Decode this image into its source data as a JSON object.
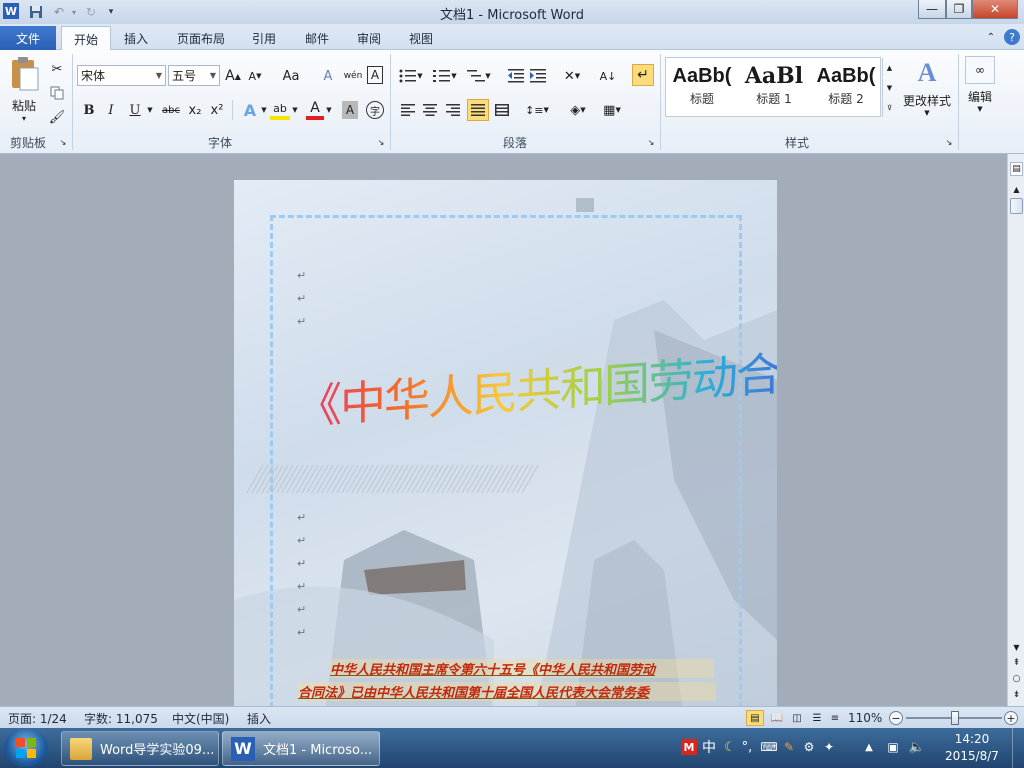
{
  "window": {
    "title": "文档1  -  Microsoft Word",
    "app_icon": "W",
    "minimize": "—",
    "restore": "❐",
    "close": "✕"
  },
  "quick_access": {
    "save_icon": "save-icon",
    "undo_icon": "undo-icon",
    "redo_icon": "redo-icon",
    "customize_icon": "dropdown-icon"
  },
  "tabs": [
    {
      "label": "文件"
    },
    {
      "label": "开始"
    },
    {
      "label": "插入"
    },
    {
      "label": "页面布局"
    },
    {
      "label": "引用"
    },
    {
      "label": "邮件"
    },
    {
      "label": "审阅"
    },
    {
      "label": "视图"
    }
  ],
  "ribbon": {
    "clipboard": {
      "paste_label": "粘贴",
      "group_label": "剪贴板"
    },
    "font": {
      "font_name": "宋体",
      "font_size": "五号",
      "grow": "A",
      "shrink": "A",
      "case": "Aa",
      "bold": "B",
      "italic": "I",
      "underline": "U",
      "strike": "abc",
      "subscript": "x₂",
      "superscript": "x²",
      "text_effect": "A",
      "highlight": "ab",
      "font_color": "A",
      "char_shading": "A",
      "enclose": "字",
      "clear": "A",
      "phonetic": "wén",
      "border_char": "A",
      "group_label": "字体"
    },
    "paragraph": {
      "group_label": "段落"
    },
    "styles": {
      "items": [
        {
          "sample": "AaBb(",
          "name": "标题"
        },
        {
          "sample": "AaBl",
          "name": "标题 1"
        },
        {
          "sample": "AaBb(",
          "name": "标题 2"
        }
      ],
      "change_styles": "更改样式",
      "group_label": "样式"
    },
    "editing": {
      "label": "编辑"
    }
  },
  "document": {
    "paragraph_mark": "↵",
    "wordart": "《中华人民共和国劳动合同法》",
    "line1": "中华人民共和国主席令第六十五号《中华人民共和国劳动",
    "line2": "合同法》已由中华人民共和国第十届全国人民代表大会常务委"
  },
  "status": {
    "page": "页面: 1/24",
    "words": "字数: 11,075",
    "language": "中文(中国)",
    "mode": "插入",
    "zoom": "110%",
    "zoom_minus": "−",
    "zoom_plus": "+",
    "zoom_level_percent": 110
  },
  "taskbar": {
    "items": [
      {
        "label": "Word导学实验09..."
      },
      {
        "label": "文档1 - Microso..."
      }
    ],
    "ime": "中",
    "time": "14:20",
    "date": "2015/8/7",
    "tray_m": "M"
  },
  "colors": {
    "accent": "#2a5fb5",
    "wordart_start": "#e8336b",
    "wordart_end": "#8a3fbf",
    "doc_text": "#c4280a"
  }
}
